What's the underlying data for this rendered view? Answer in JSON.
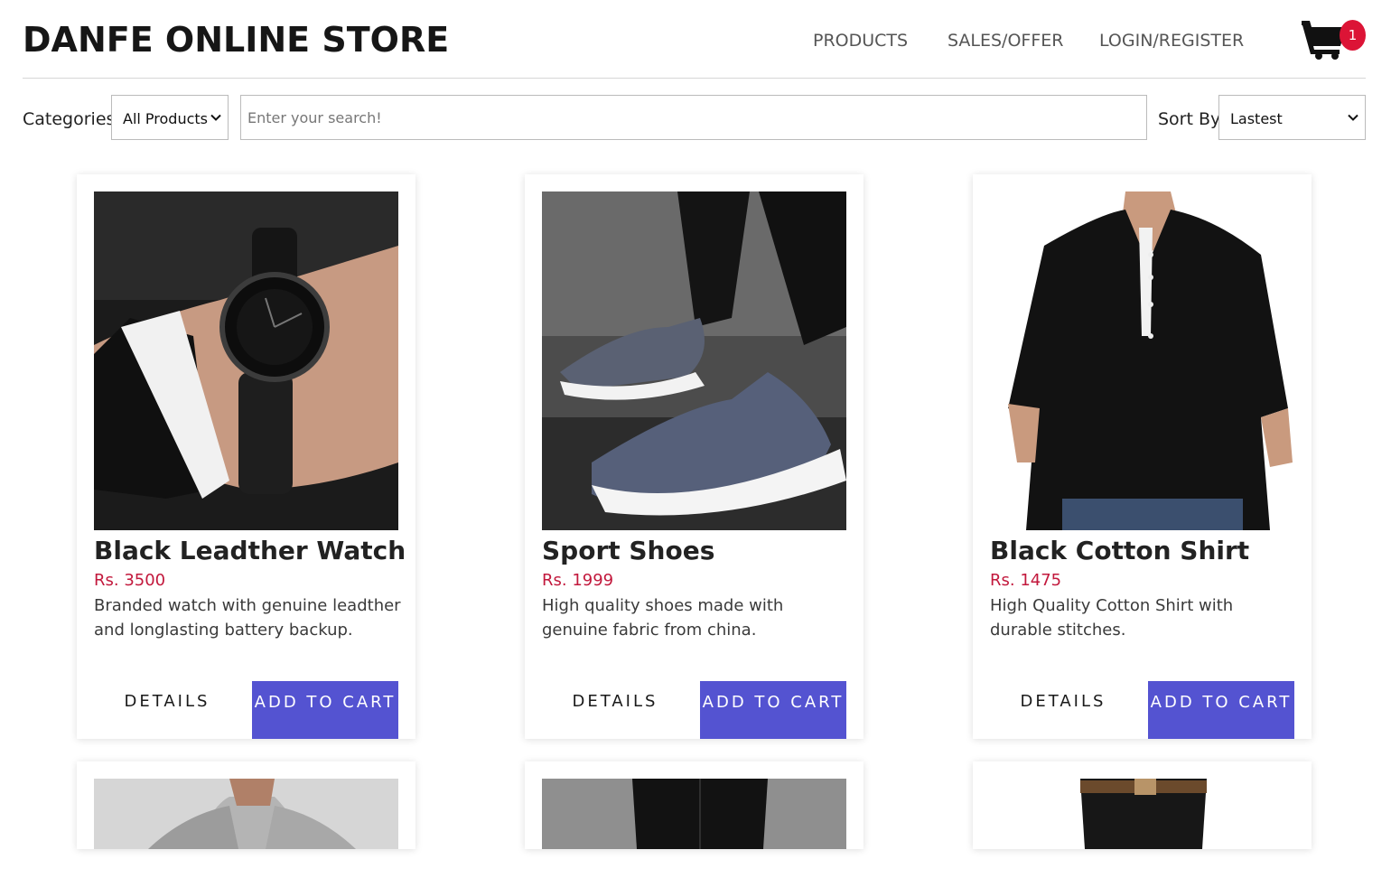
{
  "header": {
    "brand": "DANFE ONLINE STORE",
    "nav": [
      "PRODUCTS",
      "SALES/OFFER",
      "LOGIN/REGISTER"
    ],
    "cart_count": "1",
    "cart_icon": "shopping-cart-icon"
  },
  "filters": {
    "categories_label": "Categories:",
    "categories_value": "All Products",
    "search_placeholder": "Enter your search!",
    "sort_label": "Sort By:",
    "sort_value": "Lastest"
  },
  "products": [
    {
      "title": "Black Leadther Watch",
      "price": "Rs. 3500",
      "description": "Branded watch with genuine leadther and longlasting battery backup.",
      "details": "DETAILS",
      "add_to_cart": "ADD TO CART"
    },
    {
      "title": "Sport Shoes",
      "price": "Rs. 1999",
      "description": "High quality shoes made with genuine fabric from china.",
      "details": "DETAILS",
      "add_to_cart": "ADD TO CART"
    },
    {
      "title": "Black Cotton Shirt",
      "price": "Rs. 1475",
      "description": "High Quality Cotton Shirt with durable stitches.",
      "details": "DETAILS",
      "add_to_cart": "ADD TO CART"
    }
  ],
  "colors": {
    "accent": "#5453d1",
    "price": "#c2183c",
    "badge": "#dc1436"
  }
}
